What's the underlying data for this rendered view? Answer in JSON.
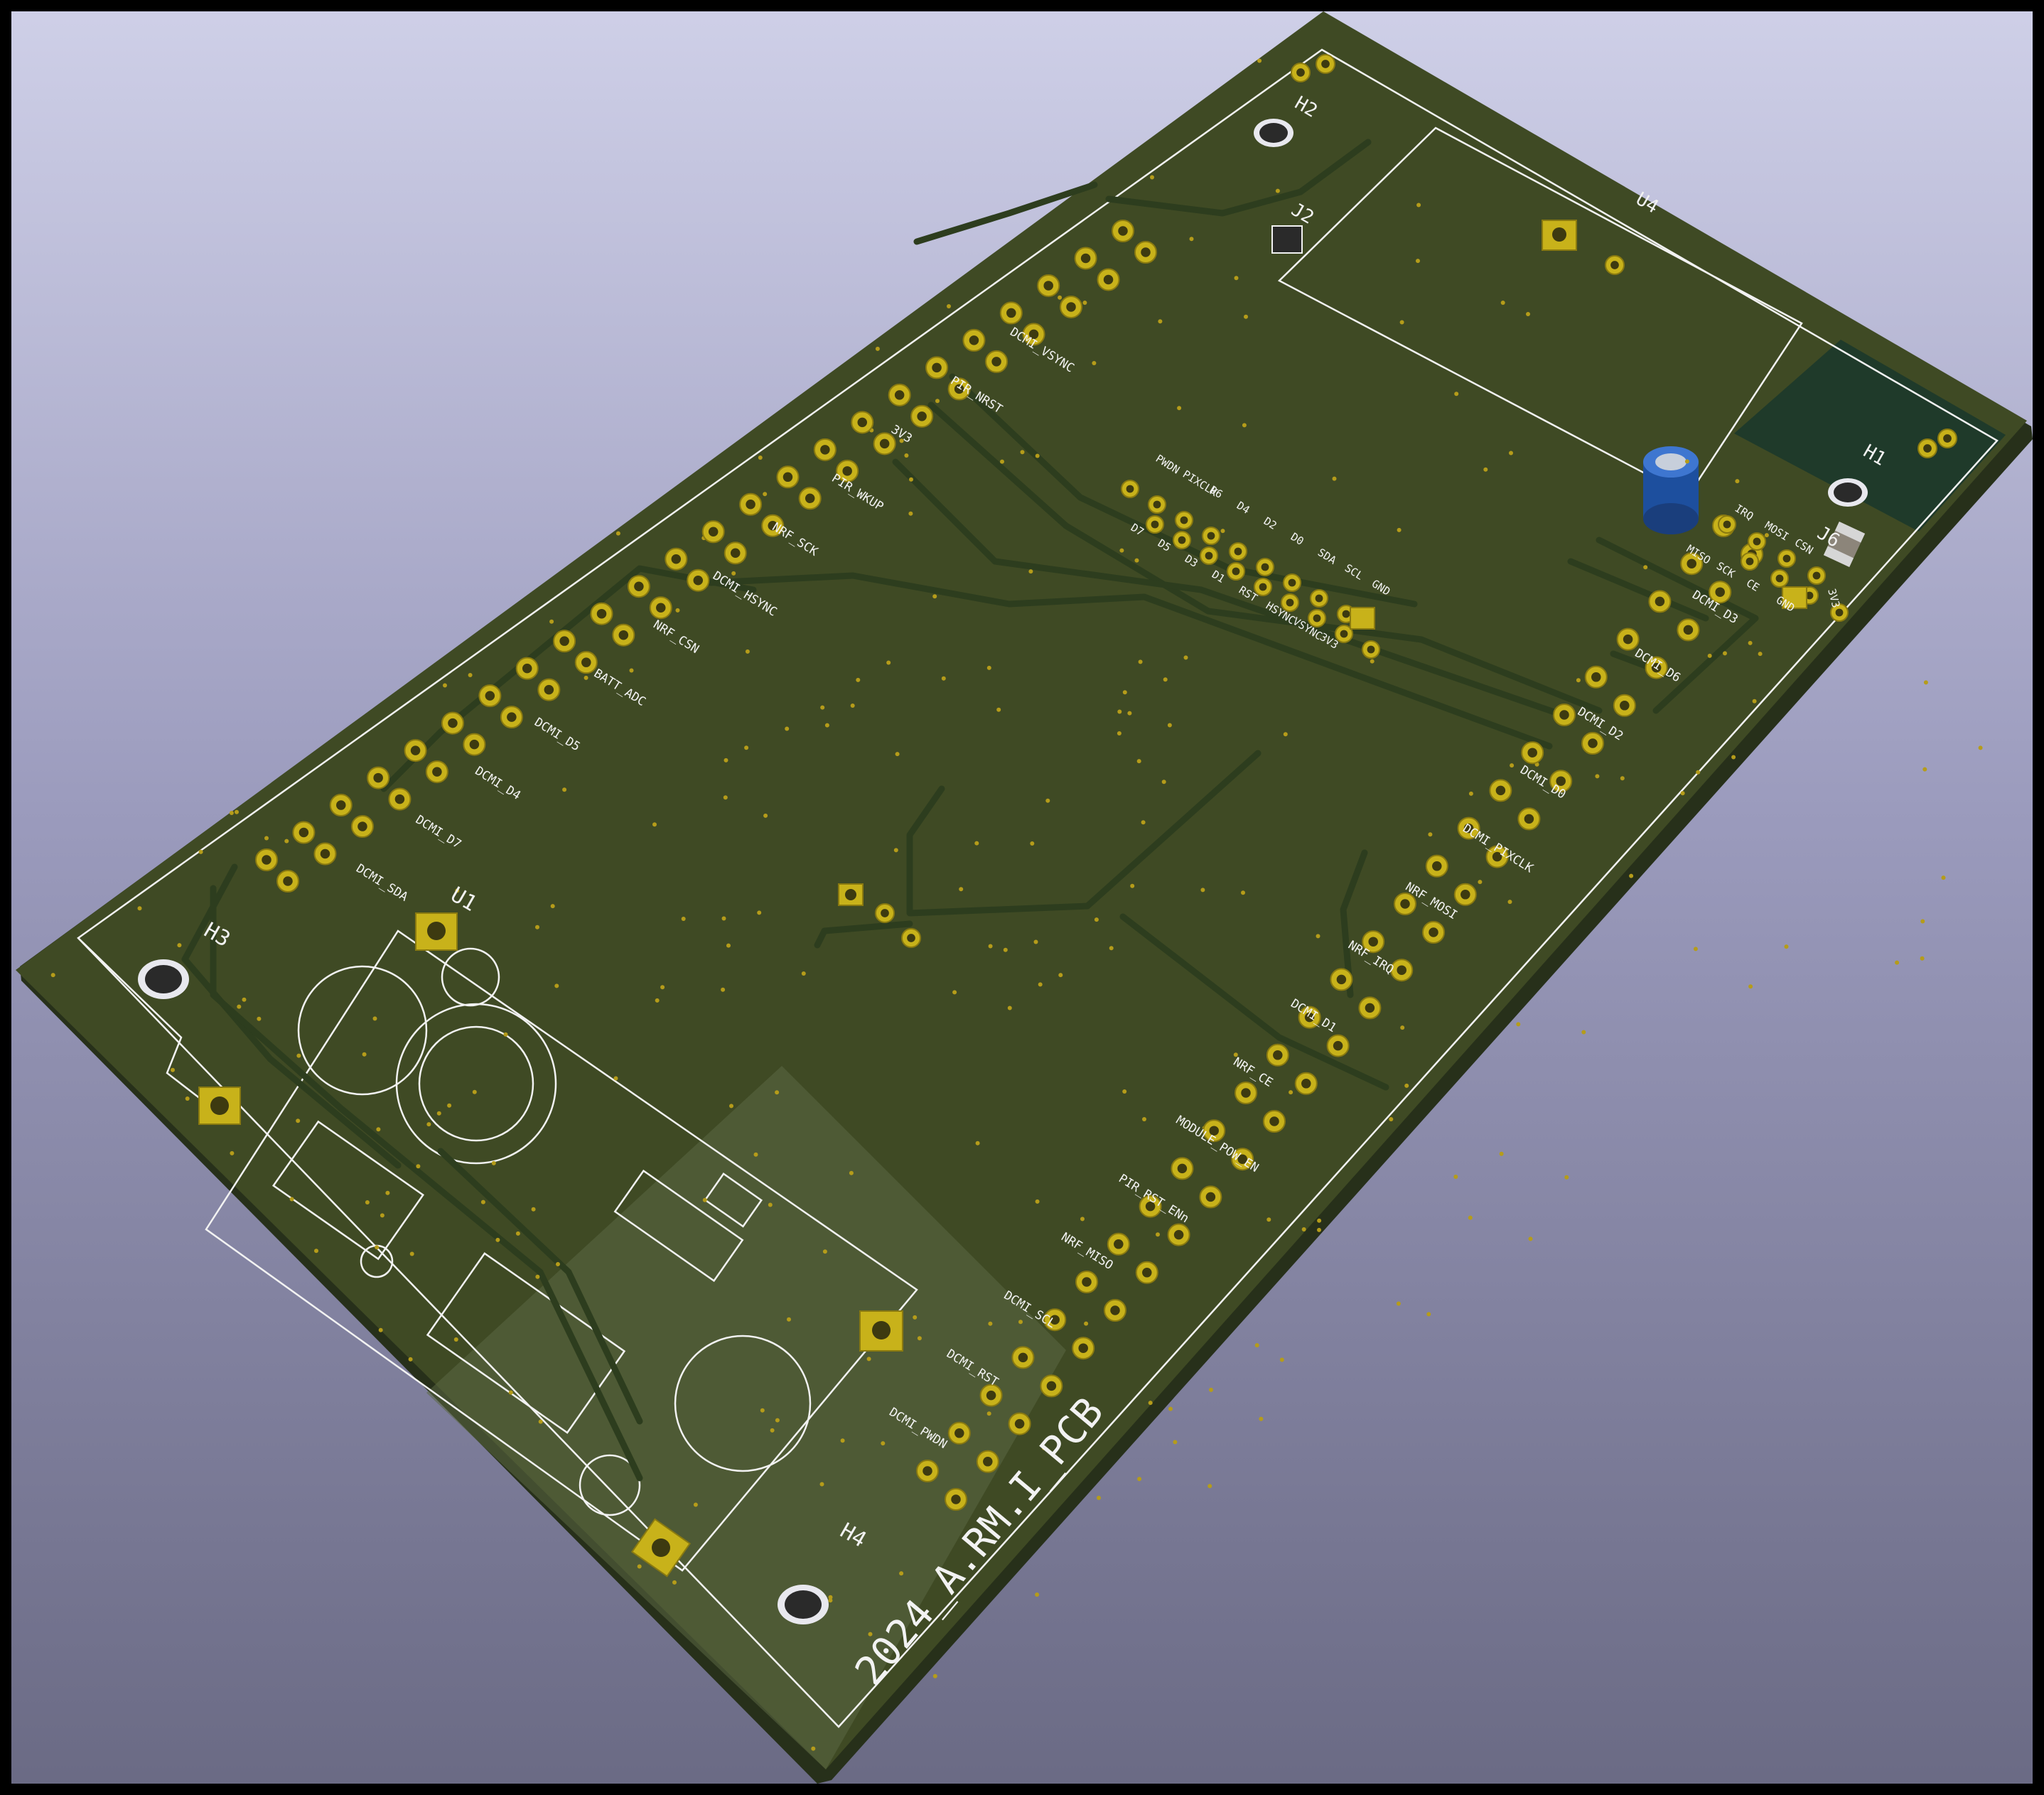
{
  "colors": {
    "board": "#3f4a24",
    "board_edge": "#27301a",
    "silkscreen": "#f2f2f2",
    "pad": "#c8b21a",
    "capacitor": "#2458b0",
    "antenna_area": "#1f3a2a"
  },
  "board": {
    "title": "2024_A.RM.I_PCB"
  },
  "refs": {
    "h1": "H1",
    "h2": "H2",
    "h3": "H3",
    "h4": "H4",
    "u1": "U1",
    "u4": "U4",
    "j2": "J2",
    "j6": "J6"
  },
  "left_header_labels": [
    "DCMI_VSYNC",
    "PIR_NRST",
    "3V3",
    "PIR_WKUP",
    "NRF_SCK",
    "DCMI_HSYNC",
    "NRF_CSN",
    "BATT_ADC",
    "DCMI_D5",
    "DCMI_D4",
    "DCMI_D7",
    "DCMI_SDA"
  ],
  "right_header_labels": [
    "DCMI_D3",
    "DCMI_D6",
    "DCMI_D2",
    "DCMI_D0",
    "DCMI_PIXCLK",
    "NRF_MOSI",
    "NRF_IRQ",
    "DCMI_D1",
    "NRF_CE",
    "MODULE_POW_EN",
    "PIR_RST_ENn",
    "NRF_MISO",
    "DCMI_SCL",
    "DCMI_RST",
    "DCMI_PWDN"
  ],
  "camera_header": {
    "top_row": [
      "PWDN",
      "PIXCLK",
      "D6",
      "D4",
      "D2",
      "D0",
      "SDA",
      "SCL",
      "GND"
    ],
    "bottom_row": [
      "D7",
      "D5",
      "D3",
      "D1",
      "RST",
      "HSYNC",
      "VSYNC",
      "3V3"
    ]
  },
  "nrf_header": {
    "top_row": [
      "IRQ",
      "MOSI",
      "CSN"
    ],
    "bottom_row": [
      "MISO",
      "SCK",
      "CE",
      "GND"
    ],
    "side_label": "3V3"
  }
}
